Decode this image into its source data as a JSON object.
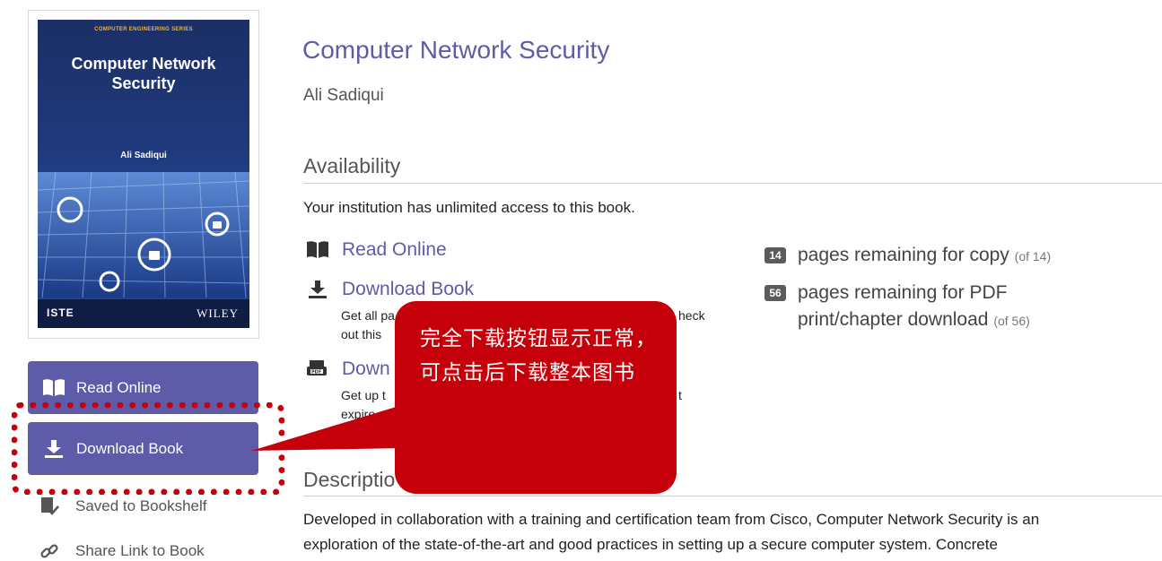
{
  "cover": {
    "series": "COMPUTER ENGINEERING SERIES",
    "title_line1": "Computer Network",
    "title_line2": "Security",
    "author": "Ali Sadiqui",
    "publisher_left": "ISTE",
    "publisher_right": "WILEY"
  },
  "sidebar": {
    "read_online": "Read Online",
    "download_book": "Download Book",
    "saved_to_bookshelf": "Saved to Bookshelf",
    "share_link": "Share Link to Book"
  },
  "book": {
    "title": "Computer Network Security",
    "author": "Ali Sadiqui"
  },
  "availability": {
    "heading": "Availability",
    "access_text": "Your institution has unlimited access to this book.",
    "options": [
      {
        "icon": "book-open-icon",
        "label": "Read Online"
      },
      {
        "icon": "download-icon",
        "label": "Download Book",
        "desc_line1": "Get all pa",
        "desc_line1_end": "heck",
        "desc_line2": "out this"
      },
      {
        "icon": "pdf-icon",
        "label": "Down",
        "desc_line1": "Get up t",
        "desc_line1_end": "t",
        "desc_line2": "expire"
      }
    ],
    "counters": [
      {
        "count": "14",
        "text": "pages remaining for copy",
        "of": "(of 14)"
      },
      {
        "count": "56",
        "text_line1": "pages remaining for PDF",
        "text_line2": "print/chapter download",
        "of": "(of 56)"
      }
    ]
  },
  "description": {
    "heading": "Descriptio",
    "line1": "Developed in collaboration with a training and certification team from Cisco, Computer Network Security is an",
    "line2": "exploration of the state-of-the-art and good practices in setting up a secure computer system. Concrete"
  },
  "annotation": {
    "text": "完全下载按钮显示正常，可点击后下载整本图书",
    "color": "#c5000b"
  },
  "colors": {
    "accent": "#5e5ca8",
    "badge": "#5b5b5b"
  }
}
